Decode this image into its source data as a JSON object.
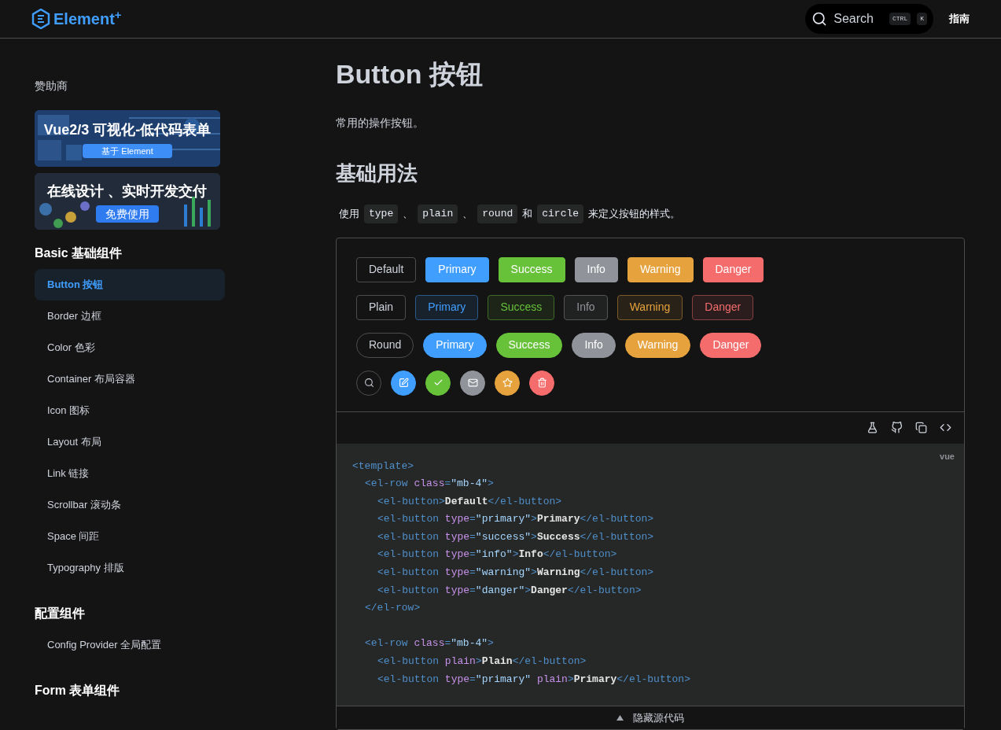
{
  "header": {
    "logo": "Element$^{+}$",
    "search": {
      "placeholder": "Search",
      "keys": [
        "CTRL",
        "K"
      ]
    },
    "nav": [
      {
        "label": "指南",
        "selected": false
      }
    ]
  },
  "sidebar": {
    "sponsor_title": "赞助商",
    "banners": [
      {
        "title": "Vue2/3 可视化-低代码表单",
        "button": "基于 Element"
      },
      {
        "title": "在线设计 、实时开发交付",
        "button": "免费使用"
      }
    ],
    "groups": [
      {
        "title": "Basic 基础组件",
        "items": [
          {
            "label": "Button 按钮",
            "selected": true
          },
          {
            "label": "Border 边框",
            "selected": false
          },
          {
            "label": "Color 色彩",
            "selected": false
          },
          {
            "label": "Container 布局容器",
            "selected": false
          },
          {
            "label": "Icon 图标",
            "selected": false
          },
          {
            "label": "Layout 布局",
            "selected": false
          },
          {
            "label": "Link 链接",
            "selected": false
          },
          {
            "label": "Scrollbar 滚动条",
            "selected": false
          },
          {
            "label": "Space 间距",
            "selected": false
          },
          {
            "label": "Typography 排版",
            "selected": false
          }
        ]
      },
      {
        "title": "配置组件",
        "items": [
          {
            "label": "Config Provider 全局配置",
            "selected": false
          }
        ]
      },
      {
        "title": "Form 表单组件"
      }
    ]
  },
  "page": {
    "title": "Button 按钮",
    "description": "常用的操作按钮。",
    "section_title": "基础用法",
    "intro": [
      {
        "kind": "text",
        "text": "使用"
      },
      {
        "kind": "code",
        "text": "type"
      },
      {
        "kind": "text",
        "text": "、"
      },
      {
        "kind": "code",
        "text": "plain"
      },
      {
        "kind": "text",
        "text": "、"
      },
      {
        "kind": "code",
        "text": "round"
      },
      {
        "kind": "text",
        "text": "和"
      },
      {
        "kind": "code",
        "text": "circle"
      },
      {
        "kind": "text",
        "text": "来定义按钮的样式。"
      }
    ],
    "demo_rows": [
      {
        "kind": "solid",
        "buttons": [
          {
            "kind": "default",
            "label": "Default"
          },
          {
            "kind": "primary",
            "label": "Primary"
          },
          {
            "kind": "success",
            "label": "Success"
          },
          {
            "kind": "info",
            "label": "Info"
          },
          {
            "kind": "warning",
            "label": "Warning"
          },
          {
            "kind": "danger",
            "label": "Danger"
          }
        ]
      },
      {
        "kind": "plain",
        "buttons": [
          {
            "kind": "default",
            "label": "Plain"
          },
          {
            "kind": "primary",
            "label": "Primary"
          },
          {
            "kind": "success",
            "label": "Success"
          },
          {
            "kind": "info",
            "label": "Info"
          },
          {
            "kind": "warning",
            "label": "Warning"
          },
          {
            "kind": "danger",
            "label": "Danger"
          }
        ]
      },
      {
        "kind": "round",
        "buttons": [
          {
            "kind": "default",
            "label": "Round"
          },
          {
            "kind": "primary",
            "label": "Primary"
          },
          {
            "kind": "success",
            "label": "Success"
          },
          {
            "kind": "info",
            "label": "Info"
          },
          {
            "kind": "warning",
            "label": "Warning"
          },
          {
            "kind": "danger",
            "label": "Danger"
          }
        ]
      },
      {
        "kind": "circle",
        "buttons": [
          {
            "kind": "default"
          },
          {
            "kind": "primary"
          },
          {
            "kind": "success"
          },
          {
            "kind": "info"
          },
          {
            "kind": "warning"
          },
          {
            "kind": "danger"
          }
        ]
      }
    ],
    "code_lang": "vue",
    "code": [
      {
        "kind": "line",
        "tokens": [
          {
            "kind": "tag",
            "text": "<template>"
          }
        ],
        "children": [
          {
            "kind": "line",
            "tokens": [
              {
                "kind": "tag",
                "text": "<el-row "
              },
              {
                "kind": "attr",
                "text": "class"
              },
              {
                "kind": "tag",
                "text": "="
              },
              {
                "kind": "string",
                "text": "\"mb-4\""
              },
              {
                "kind": "tag",
                "text": ">"
              }
            ],
            "children": [
              {
                "kind": "line",
                "tokens": [
                  {
                    "kind": "tag",
                    "text": "<el-button>"
                  },
                  {
                    "kind": "text",
                    "text": "Default"
                  },
                  {
                    "kind": "tag",
                    "text": "</el-button>"
                  }
                ]
              },
              {
                "kind": "line",
                "tokens": [
                  {
                    "kind": "tag",
                    "text": "<el-button "
                  },
                  {
                    "kind": "attr",
                    "text": "type"
                  },
                  {
                    "kind": "tag",
                    "text": "="
                  },
                  {
                    "kind": "string",
                    "text": "\"primary\""
                  },
                  {
                    "kind": "tag",
                    "text": ">"
                  },
                  {
                    "kind": "text",
                    "text": "Primary"
                  },
                  {
                    "kind": "tag",
                    "text": "</el-button>"
                  }
                ]
              },
              {
                "kind": "line",
                "tokens": [
                  {
                    "kind": "tag",
                    "text": "<el-button "
                  },
                  {
                    "kind": "attr",
                    "text": "type"
                  },
                  {
                    "kind": "tag",
                    "text": "="
                  },
                  {
                    "kind": "string",
                    "text": "\"success\""
                  },
                  {
                    "kind": "tag",
                    "text": ">"
                  },
                  {
                    "kind": "text",
                    "text": "Success"
                  },
                  {
                    "kind": "tag",
                    "text": "</el-button>"
                  }
                ]
              },
              {
                "kind": "line",
                "tokens": [
                  {
                    "kind": "tag",
                    "text": "<el-button "
                  },
                  {
                    "kind": "attr",
                    "text": "type"
                  },
                  {
                    "kind": "tag",
                    "text": "="
                  },
                  {
                    "kind": "string",
                    "text": "\"info\""
                  },
                  {
                    "kind": "tag",
                    "text": ">"
                  },
                  {
                    "kind": "text",
                    "text": "Info"
                  },
                  {
                    "kind": "tag",
                    "text": "</el-button>"
                  }
                ]
              },
              {
                "kind": "line",
                "tokens": [
                  {
                    "kind": "tag",
                    "text": "<el-button "
                  },
                  {
                    "kind": "attr",
                    "text": "type"
                  },
                  {
                    "kind": "tag",
                    "text": "="
                  },
                  {
                    "kind": "string",
                    "text": "\"warning\""
                  },
                  {
                    "kind": "tag",
                    "text": ">"
                  },
                  {
                    "kind": "text",
                    "text": "Warning"
                  },
                  {
                    "kind": "tag",
                    "text": "</el-button>"
                  }
                ]
              },
              {
                "kind": "line",
                "tokens": [
                  {
                    "kind": "tag",
                    "text": "<el-button "
                  },
                  {
                    "kind": "attr",
                    "text": "type"
                  },
                  {
                    "kind": "tag",
                    "text": "="
                  },
                  {
                    "kind": "string",
                    "text": "\"danger\""
                  },
                  {
                    "kind": "tag",
                    "text": ">"
                  },
                  {
                    "kind": "text",
                    "text": "Danger"
                  },
                  {
                    "kind": "tag",
                    "text": "</el-button>"
                  }
                ]
              }
            ]
          },
          {
            "kind": "line",
            "tokens": [
              {
                "kind": "tag",
                "text": "</el-row>"
              }
            ]
          },
          {
            "kind": "blank"
          },
          {
            "kind": "line",
            "tokens": [
              {
                "kind": "tag",
                "text": "<el-row "
              },
              {
                "kind": "attr",
                "text": "class"
              },
              {
                "kind": "tag",
                "text": "="
              },
              {
                "kind": "string",
                "text": "\"mb-4\""
              },
              {
                "kind": "tag",
                "text": ">"
              }
            ],
            "children": [
              {
                "kind": "line",
                "tokens": [
                  {
                    "kind": "tag",
                    "text": "<el-button "
                  },
                  {
                    "kind": "attr",
                    "text": "plain"
                  },
                  {
                    "kind": "tag",
                    "text": ">"
                  },
                  {
                    "kind": "text",
                    "text": "Plain"
                  },
                  {
                    "kind": "tag",
                    "text": "</el-button>"
                  }
                ]
              },
              {
                "kind": "line",
                "tokens": [
                  {
                    "kind": "tag",
                    "text": "<el-button "
                  },
                  {
                    "kind": "attr",
                    "text": "type"
                  },
                  {
                    "kind": "tag",
                    "text": "="
                  },
                  {
                    "kind": "string",
                    "text": "\"primary\""
                  },
                  {
                    "kind": "attr",
                    "text": " plain"
                  },
                  {
                    "kind": "tag",
                    "text": ">"
                  },
                  {
                    "kind": "text",
                    "text": "Primary"
                  },
                  {
                    "kind": "tag",
                    "text": "</el-button>"
                  }
                ]
              }
            ]
          }
        ]
      }
    ],
    "toggle_label": "隐藏源代码"
  }
}
